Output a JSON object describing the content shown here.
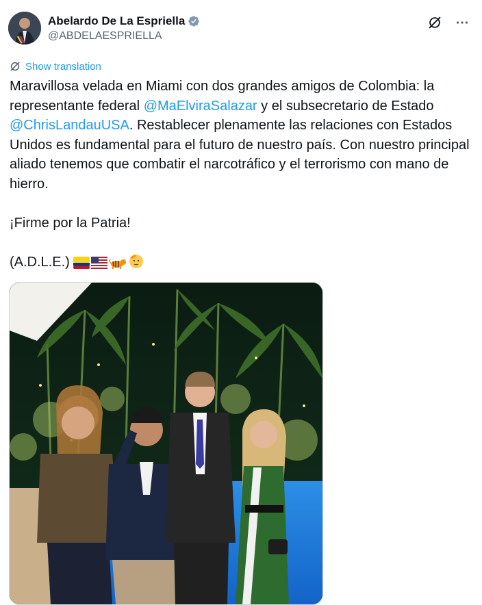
{
  "author": {
    "display_name": "Abelardo De La Espriella",
    "handle": "@ABDELAESPRIELLA",
    "verified": true,
    "avatar_icon": "avatar-photo"
  },
  "top_icons": [
    "grok-icon",
    "more-icon"
  ],
  "show_translation": "Show translation",
  "tweet": {
    "line1_pre": "Maravillosa velada en Miami con dos grandes amigos de Colombia: la representante federal ",
    "mention1": "@MaElviraSalazar",
    "line1_mid": " y el subsecretario de Estado ",
    "mention2": "@ChrisLandauUSA",
    "line1_post": ". Restablecer plenamente las relaciones con Estados Unidos es fundamental para el futuro de nuestro país. Con nuestro principal aliado tenemos que combatir el narcotráfico y el terrorismo con mano de hierro.",
    "paragraph2": "¡Firme por la Patria!",
    "paragraph3": "(A.D.L.E.)",
    "emojis": [
      "colombia-flag",
      "usa-flag",
      "tiger",
      "saluting-face"
    ]
  },
  "colors": {
    "accent": "#1d9bf0",
    "text": "#0f1419",
    "secondary": "#536471"
  },
  "media": {
    "kind": "photo",
    "subject_icon": "group-photo-at-pool"
  }
}
